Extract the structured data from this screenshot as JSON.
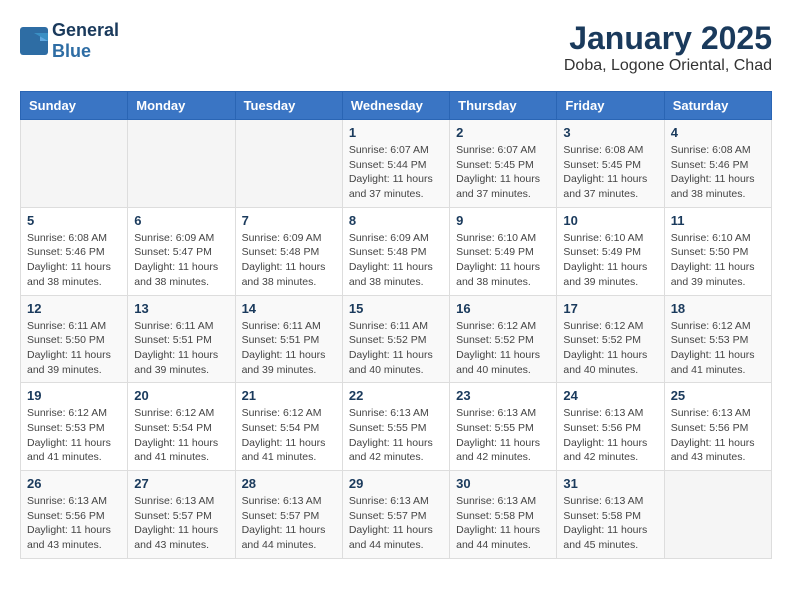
{
  "header": {
    "logo_line1": "General",
    "logo_line2": "Blue",
    "month": "January 2025",
    "location": "Doba, Logone Oriental, Chad"
  },
  "days_of_week": [
    "Sunday",
    "Monday",
    "Tuesday",
    "Wednesday",
    "Thursday",
    "Friday",
    "Saturday"
  ],
  "weeks": [
    [
      {
        "day": "",
        "sunrise": "",
        "sunset": "",
        "daylight": ""
      },
      {
        "day": "",
        "sunrise": "",
        "sunset": "",
        "daylight": ""
      },
      {
        "day": "",
        "sunrise": "",
        "sunset": "",
        "daylight": ""
      },
      {
        "day": "1",
        "sunrise": "Sunrise: 6:07 AM",
        "sunset": "Sunset: 5:44 PM",
        "daylight": "Daylight: 11 hours and 37 minutes."
      },
      {
        "day": "2",
        "sunrise": "Sunrise: 6:07 AM",
        "sunset": "Sunset: 5:45 PM",
        "daylight": "Daylight: 11 hours and 37 minutes."
      },
      {
        "day": "3",
        "sunrise": "Sunrise: 6:08 AM",
        "sunset": "Sunset: 5:45 PM",
        "daylight": "Daylight: 11 hours and 37 minutes."
      },
      {
        "day": "4",
        "sunrise": "Sunrise: 6:08 AM",
        "sunset": "Sunset: 5:46 PM",
        "daylight": "Daylight: 11 hours and 38 minutes."
      }
    ],
    [
      {
        "day": "5",
        "sunrise": "Sunrise: 6:08 AM",
        "sunset": "Sunset: 5:46 PM",
        "daylight": "Daylight: 11 hours and 38 minutes."
      },
      {
        "day": "6",
        "sunrise": "Sunrise: 6:09 AM",
        "sunset": "Sunset: 5:47 PM",
        "daylight": "Daylight: 11 hours and 38 minutes."
      },
      {
        "day": "7",
        "sunrise": "Sunrise: 6:09 AM",
        "sunset": "Sunset: 5:48 PM",
        "daylight": "Daylight: 11 hours and 38 minutes."
      },
      {
        "day": "8",
        "sunrise": "Sunrise: 6:09 AM",
        "sunset": "Sunset: 5:48 PM",
        "daylight": "Daylight: 11 hours and 38 minutes."
      },
      {
        "day": "9",
        "sunrise": "Sunrise: 6:10 AM",
        "sunset": "Sunset: 5:49 PM",
        "daylight": "Daylight: 11 hours and 38 minutes."
      },
      {
        "day": "10",
        "sunrise": "Sunrise: 6:10 AM",
        "sunset": "Sunset: 5:49 PM",
        "daylight": "Daylight: 11 hours and 39 minutes."
      },
      {
        "day": "11",
        "sunrise": "Sunrise: 6:10 AM",
        "sunset": "Sunset: 5:50 PM",
        "daylight": "Daylight: 11 hours and 39 minutes."
      }
    ],
    [
      {
        "day": "12",
        "sunrise": "Sunrise: 6:11 AM",
        "sunset": "Sunset: 5:50 PM",
        "daylight": "Daylight: 11 hours and 39 minutes."
      },
      {
        "day": "13",
        "sunrise": "Sunrise: 6:11 AM",
        "sunset": "Sunset: 5:51 PM",
        "daylight": "Daylight: 11 hours and 39 minutes."
      },
      {
        "day": "14",
        "sunrise": "Sunrise: 6:11 AM",
        "sunset": "Sunset: 5:51 PM",
        "daylight": "Daylight: 11 hours and 39 minutes."
      },
      {
        "day": "15",
        "sunrise": "Sunrise: 6:11 AM",
        "sunset": "Sunset: 5:52 PM",
        "daylight": "Daylight: 11 hours and 40 minutes."
      },
      {
        "day": "16",
        "sunrise": "Sunrise: 6:12 AM",
        "sunset": "Sunset: 5:52 PM",
        "daylight": "Daylight: 11 hours and 40 minutes."
      },
      {
        "day": "17",
        "sunrise": "Sunrise: 6:12 AM",
        "sunset": "Sunset: 5:52 PM",
        "daylight": "Daylight: 11 hours and 40 minutes."
      },
      {
        "day": "18",
        "sunrise": "Sunrise: 6:12 AM",
        "sunset": "Sunset: 5:53 PM",
        "daylight": "Daylight: 11 hours and 41 minutes."
      }
    ],
    [
      {
        "day": "19",
        "sunrise": "Sunrise: 6:12 AM",
        "sunset": "Sunset: 5:53 PM",
        "daylight": "Daylight: 11 hours and 41 minutes."
      },
      {
        "day": "20",
        "sunrise": "Sunrise: 6:12 AM",
        "sunset": "Sunset: 5:54 PM",
        "daylight": "Daylight: 11 hours and 41 minutes."
      },
      {
        "day": "21",
        "sunrise": "Sunrise: 6:12 AM",
        "sunset": "Sunset: 5:54 PM",
        "daylight": "Daylight: 11 hours and 41 minutes."
      },
      {
        "day": "22",
        "sunrise": "Sunrise: 6:13 AM",
        "sunset": "Sunset: 5:55 PM",
        "daylight": "Daylight: 11 hours and 42 minutes."
      },
      {
        "day": "23",
        "sunrise": "Sunrise: 6:13 AM",
        "sunset": "Sunset: 5:55 PM",
        "daylight": "Daylight: 11 hours and 42 minutes."
      },
      {
        "day": "24",
        "sunrise": "Sunrise: 6:13 AM",
        "sunset": "Sunset: 5:56 PM",
        "daylight": "Daylight: 11 hours and 42 minutes."
      },
      {
        "day": "25",
        "sunrise": "Sunrise: 6:13 AM",
        "sunset": "Sunset: 5:56 PM",
        "daylight": "Daylight: 11 hours and 43 minutes."
      }
    ],
    [
      {
        "day": "26",
        "sunrise": "Sunrise: 6:13 AM",
        "sunset": "Sunset: 5:56 PM",
        "daylight": "Daylight: 11 hours and 43 minutes."
      },
      {
        "day": "27",
        "sunrise": "Sunrise: 6:13 AM",
        "sunset": "Sunset: 5:57 PM",
        "daylight": "Daylight: 11 hours and 43 minutes."
      },
      {
        "day": "28",
        "sunrise": "Sunrise: 6:13 AM",
        "sunset": "Sunset: 5:57 PM",
        "daylight": "Daylight: 11 hours and 44 minutes."
      },
      {
        "day": "29",
        "sunrise": "Sunrise: 6:13 AM",
        "sunset": "Sunset: 5:57 PM",
        "daylight": "Daylight: 11 hours and 44 minutes."
      },
      {
        "day": "30",
        "sunrise": "Sunrise: 6:13 AM",
        "sunset": "Sunset: 5:58 PM",
        "daylight": "Daylight: 11 hours and 44 minutes."
      },
      {
        "day": "31",
        "sunrise": "Sunrise: 6:13 AM",
        "sunset": "Sunset: 5:58 PM",
        "daylight": "Daylight: 11 hours and 45 minutes."
      },
      {
        "day": "",
        "sunrise": "",
        "sunset": "",
        "daylight": ""
      }
    ]
  ]
}
